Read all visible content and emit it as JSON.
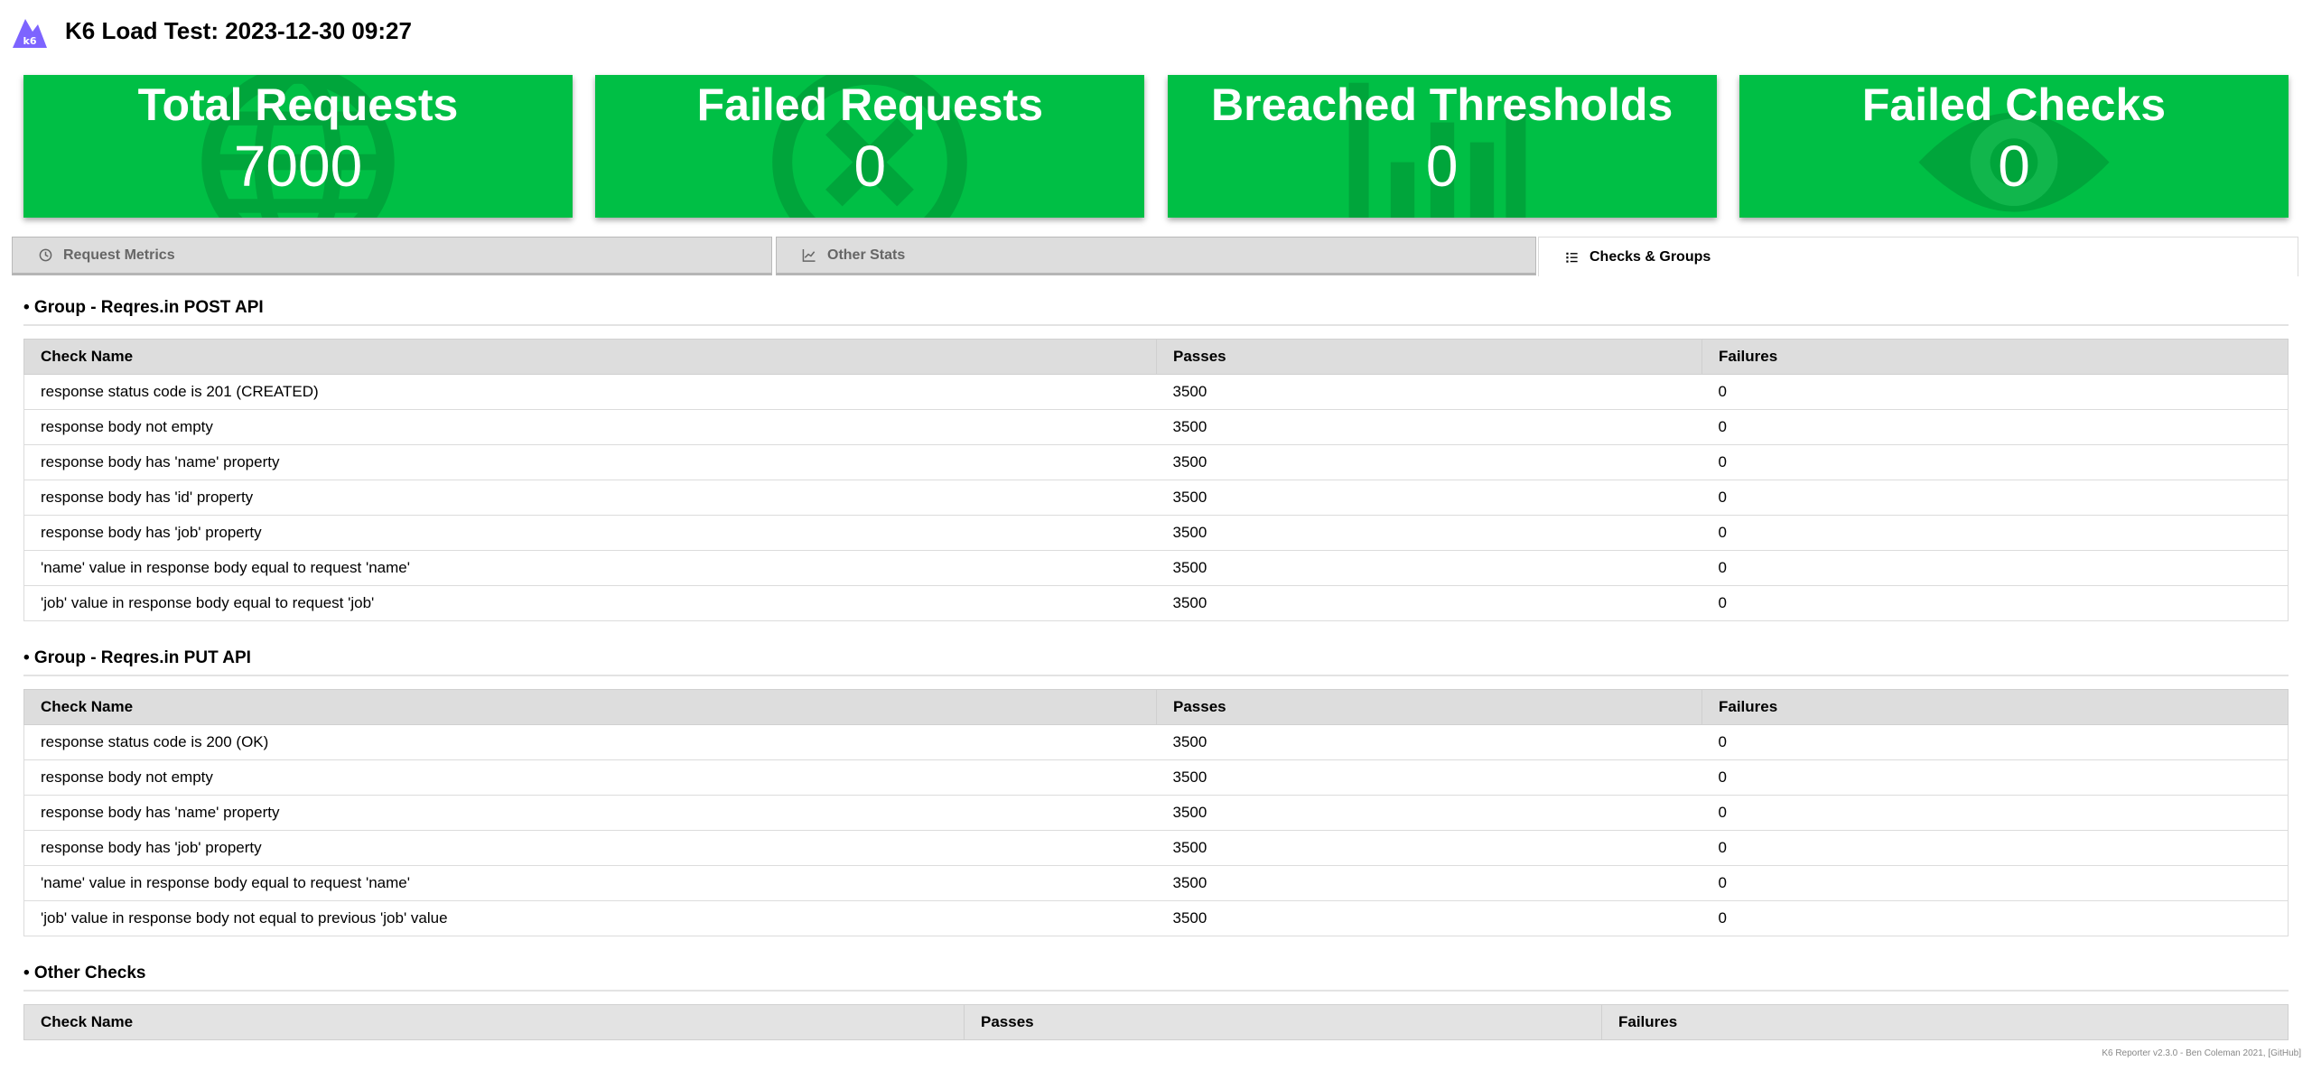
{
  "header": {
    "logo_text": "k6",
    "title": "K6 Load Test: 2023-12-30 09:27"
  },
  "colors": {
    "accent_green": "#00bf45",
    "logo_purple": "#7d64ff"
  },
  "summary": [
    {
      "title": "Total Requests",
      "value": "7000",
      "icon": "globe-icon"
    },
    {
      "title": "Failed Requests",
      "value": "0",
      "icon": "times-circle-icon"
    },
    {
      "title": "Breached Thresholds",
      "value": "0",
      "icon": "chart-bar-icon"
    },
    {
      "title": "Failed Checks",
      "value": "0",
      "icon": "eye-icon"
    }
  ],
  "tabs": [
    {
      "label": "Request Metrics",
      "icon": "clock-icon",
      "active": false
    },
    {
      "label": "Other Stats",
      "icon": "chart-line-icon",
      "active": false
    },
    {
      "label": "Checks & Groups",
      "icon": "list-icon",
      "active": true
    }
  ],
  "columns": {
    "name": "Check Name",
    "passes": "Passes",
    "failures": "Failures"
  },
  "groups": [
    {
      "title": "• Group - Reqres.in POST API",
      "rows": [
        {
          "name": "response status code is 201 (CREATED)",
          "passes": "3500",
          "failures": "0"
        },
        {
          "name": "response body not empty",
          "passes": "3500",
          "failures": "0"
        },
        {
          "name": "response body has 'name' property",
          "passes": "3500",
          "failures": "0"
        },
        {
          "name": "response body has 'id' property",
          "passes": "3500",
          "failures": "0"
        },
        {
          "name": "response body has 'job' property",
          "passes": "3500",
          "failures": "0"
        },
        {
          "name": "'name' value in response body equal to request 'name'",
          "passes": "3500",
          "failures": "0"
        },
        {
          "name": "'job' value in response body equal to request 'job'",
          "passes": "3500",
          "failures": "0"
        }
      ]
    },
    {
      "title": "• Group - Reqres.in PUT API",
      "rows": [
        {
          "name": "response status code is 200 (OK)",
          "passes": "3500",
          "failures": "0"
        },
        {
          "name": "response body not empty",
          "passes": "3500",
          "failures": "0"
        },
        {
          "name": "response body has 'name' property",
          "passes": "3500",
          "failures": "0"
        },
        {
          "name": "response body has 'job' property",
          "passes": "3500",
          "failures": "0"
        },
        {
          "name": "'name' value in response body equal to request 'name'",
          "passes": "3500",
          "failures": "0"
        },
        {
          "name": "'job' value in response body not equal to previous 'job' value",
          "passes": "3500",
          "failures": "0"
        }
      ]
    }
  ],
  "other_checks": {
    "title": "• Other Checks"
  },
  "footer": {
    "text": "K6 Reporter v2.3.0 - Ben Coleman 2021,",
    "link": "[GitHub]"
  }
}
